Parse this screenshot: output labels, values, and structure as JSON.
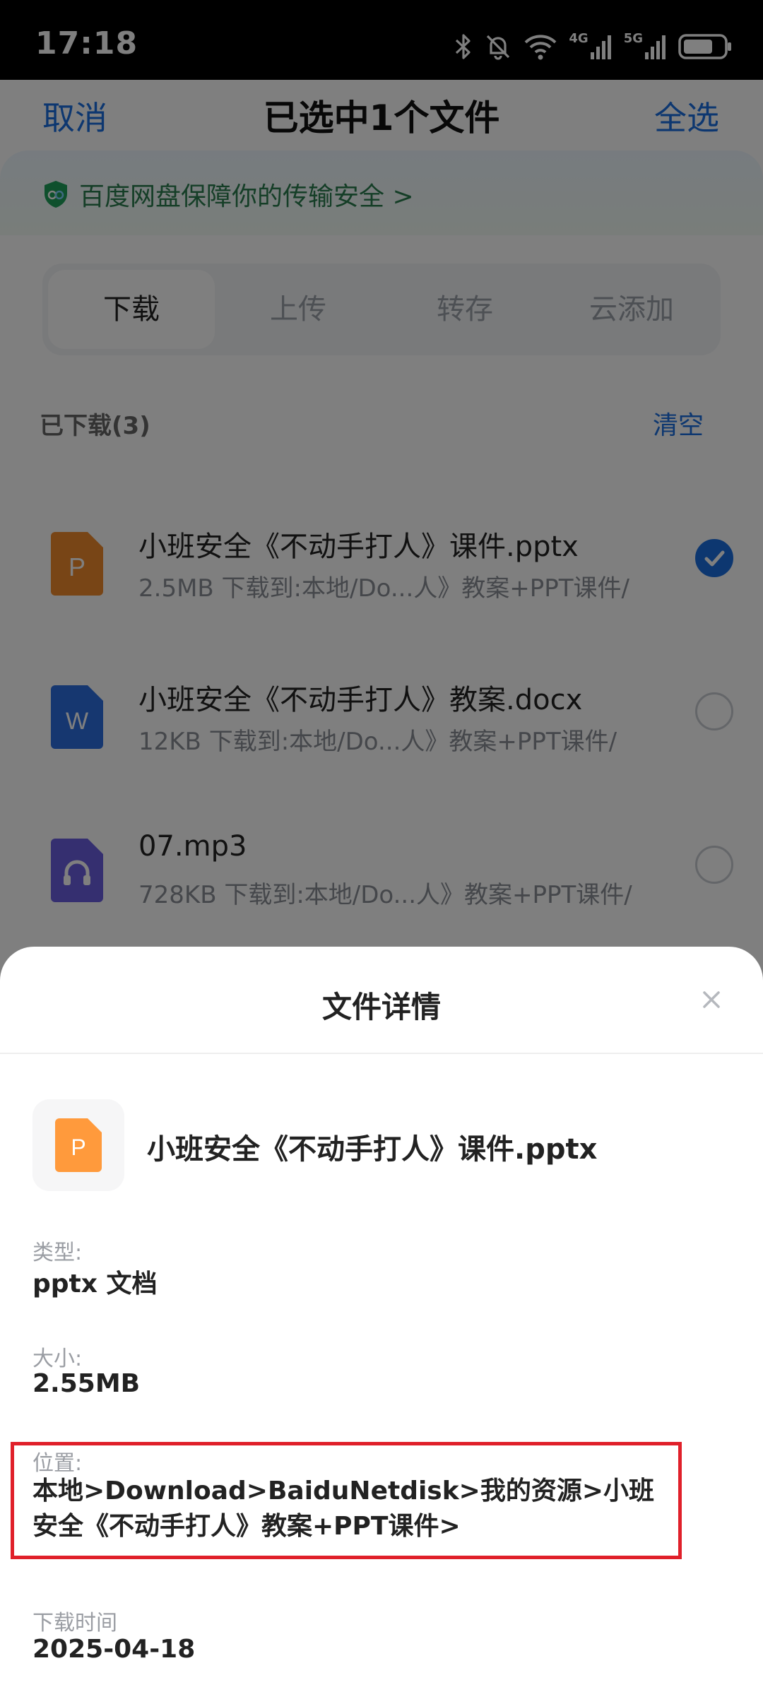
{
  "status_bar": {
    "time": "17:18",
    "network_1": "4G",
    "network_2": "5G"
  },
  "header": {
    "cancel": "取消",
    "title": "已选中1个文件",
    "select_all": "全选"
  },
  "banner": {
    "text": "百度网盘保障你的传输安全 >"
  },
  "tabs": [
    {
      "label": "下载",
      "active": true
    },
    {
      "label": "上传",
      "active": false
    },
    {
      "label": "转存",
      "active": false
    },
    {
      "label": "云添加",
      "active": false
    }
  ],
  "section": {
    "title": "已下载(3)",
    "clear": "清空"
  },
  "files": [
    {
      "name": "小班安全《不动手打人》课件.pptx",
      "meta": "2.5MB 下载到:本地/Do...人》教案+PPT课件/",
      "type_icon": "pptx-icon",
      "icon_letter": "P",
      "color": "#f08a2c",
      "selected": true
    },
    {
      "name": "小班安全《不动手打人》教案.docx",
      "meta": "12KB 下载到:本地/Do...人》教案+PPT课件/",
      "type_icon": "docx-icon",
      "icon_letter": "W",
      "color": "#2c6fe0",
      "selected": false
    },
    {
      "name": "07.mp3",
      "meta": "728KB 下载到:本地/Do...人》教案+PPT课件/",
      "type_icon": "audio-icon",
      "icon_letter": "",
      "color": "#6b5fe0",
      "selected": false
    }
  ],
  "sheet": {
    "title": "文件详情",
    "file_name": "小班安全《不动手打人》课件.pptx",
    "type_label": "类型:",
    "type_value": "pptx 文档",
    "size_label": "大小:",
    "size_value": "2.55MB",
    "location_label": "位置:",
    "location_value": "本地>Download>BaiduNetdisk>我的资源>小班安全《不动手打人》教案+PPT课件>",
    "time_label": "下载时间",
    "time_value": "2025-04-18"
  },
  "colors": {
    "accent": "#1b6fe0",
    "highlight": "#e0202a",
    "pptx": "#f08a2c"
  }
}
